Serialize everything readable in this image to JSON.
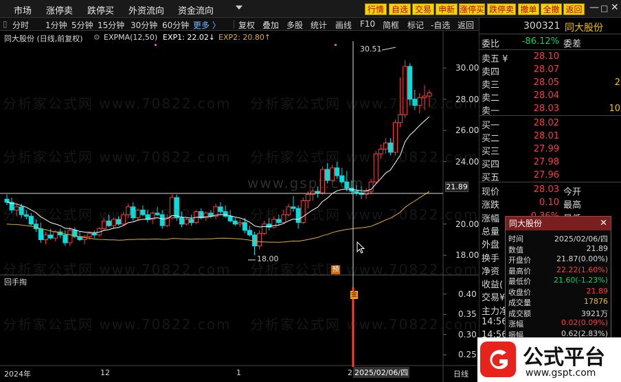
{
  "menu": {
    "items": [
      "市场",
      "涨停卖",
      "跌停买",
      "外资流向",
      "资金流向"
    ],
    "buttons": [
      "行情",
      "自选",
      "交易",
      "申新",
      "涨停买",
      "跌停卖",
      "撤单",
      "全撤",
      "返回"
    ],
    "controls": [
      "—",
      "□",
      "✕"
    ]
  },
  "toolbar": {
    "periods": [
      "分时",
      "1分钟",
      "5分钟",
      "15分钟",
      "30分钟",
      "60分钟",
      "更多 〉"
    ],
    "tools": [
      "复权",
      "叠加",
      "多股",
      "统计",
      "画线",
      "F10",
      "简框",
      "标记",
      "-自选",
      "返回"
    ]
  },
  "legend": {
    "stock": "同大股份 (日线,前复权)",
    "indicator": "EXPMA(12,50)",
    "exp1": "EXP1: 22.02↓",
    "exp2": "EXP2: 20.80↑"
  },
  "chart_labels": {
    "high_marker": "30.51",
    "low_marker": "18.00",
    "cursor_price": "21.89",
    "pre_tag": "预",
    "sub_title": "回手掏",
    "sub_marker": "金",
    "x_labels": [
      "2024年",
      "12",
      "1",
      "2",
      "2025/02/06/四"
    ],
    "period_label": "日线"
  },
  "chart_data": {
    "type": "candlestick",
    "price_axis": [
      30.0,
      28.0,
      26.0,
      24.0,
      22.0,
      20.0,
      18.0
    ],
    "price_axis_labels": [
      "30.00",
      "28.00",
      "26.00",
      "24.00",
      "20.00",
      "18.00"
    ],
    "ylim": [
      17.0,
      31.5
    ],
    "sub_axis_labels": [
      "0.40",
      "0.35",
      "0.30",
      "0.25"
    ],
    "sub_ylim": [
      0.22,
      0.42
    ],
    "candles": [
      [
        21.6,
        21.9,
        21.2,
        21.4
      ],
      [
        21.4,
        21.7,
        20.7,
        20.9
      ],
      [
        20.9,
        21.3,
        20.5,
        21.1
      ],
      [
        21.1,
        21.3,
        20.4,
        20.6
      ],
      [
        20.6,
        20.9,
        20.3,
        20.5
      ],
      [
        20.5,
        20.7,
        19.9,
        20.0
      ],
      [
        20.0,
        20.3,
        19.5,
        19.7
      ],
      [
        19.7,
        20.1,
        18.8,
        19.0
      ],
      [
        19.0,
        19.5,
        18.7,
        19.3
      ],
      [
        19.3,
        19.7,
        19.0,
        19.1
      ],
      [
        19.1,
        19.6,
        18.9,
        19.5
      ],
      [
        19.5,
        19.7,
        19.1,
        19.3
      ],
      [
        19.3,
        19.6,
        18.6,
        18.8
      ],
      [
        18.8,
        19.8,
        18.6,
        19.6
      ],
      [
        19.6,
        19.8,
        19.1,
        19.2
      ],
      [
        19.2,
        19.5,
        18.9,
        19.0
      ],
      [
        19.0,
        19.3,
        18.7,
        19.2
      ],
      [
        19.2,
        19.5,
        19.0,
        19.4
      ],
      [
        19.4,
        19.6,
        19.1,
        19.3
      ],
      [
        19.3,
        19.8,
        19.2,
        19.7
      ],
      [
        19.7,
        20.4,
        19.6,
        20.2
      ],
      [
        20.2,
        20.6,
        19.8,
        19.9
      ],
      [
        19.9,
        20.4,
        19.7,
        20.3
      ],
      [
        20.3,
        20.5,
        19.9,
        20.0
      ],
      [
        20.0,
        20.8,
        19.9,
        20.6
      ],
      [
        20.6,
        21.3,
        20.4,
        21.1
      ],
      [
        21.1,
        21.4,
        20.2,
        20.4
      ],
      [
        20.4,
        21.0,
        20.2,
        20.9
      ],
      [
        20.9,
        21.2,
        20.5,
        20.6
      ],
      [
        20.6,
        20.9,
        20.1,
        20.3
      ],
      [
        20.3,
        20.8,
        20.0,
        20.7
      ],
      [
        20.7,
        21.1,
        20.5,
        20.6
      ],
      [
        20.6,
        20.9,
        19.7,
        19.9
      ],
      [
        19.9,
        20.6,
        19.8,
        20.4
      ],
      [
        20.4,
        21.9,
        20.3,
        21.7
      ],
      [
        21.7,
        21.9,
        20.2,
        20.4
      ],
      [
        20.4,
        20.8,
        19.8,
        20.0
      ],
      [
        20.0,
        20.4,
        19.9,
        20.3
      ],
      [
        20.3,
        20.6,
        19.9,
        20.1
      ],
      [
        20.1,
        20.9,
        20.0,
        20.8
      ],
      [
        20.8,
        21.0,
        20.3,
        20.4
      ],
      [
        20.4,
        20.8,
        20.2,
        20.7
      ],
      [
        20.7,
        20.9,
        20.4,
        20.5
      ],
      [
        20.5,
        21.3,
        20.3,
        21.1
      ],
      [
        21.1,
        21.4,
        20.6,
        20.8
      ],
      [
        20.8,
        21.2,
        20.4,
        20.5
      ],
      [
        20.5,
        20.9,
        20.1,
        20.2
      ],
      [
        20.2,
        20.4,
        19.9,
        20.0
      ],
      [
        20.0,
        20.3,
        19.8,
        20.1
      ],
      [
        20.1,
        20.4,
        19.4,
        19.6
      ],
      [
        19.6,
        19.9,
        19.2,
        19.3
      ],
      [
        19.3,
        19.5,
        18.0,
        18.6
      ],
      [
        18.6,
        19.6,
        18.4,
        19.4
      ],
      [
        19.4,
        20.2,
        19.3,
        20.0
      ],
      [
        20.0,
        20.4,
        19.6,
        19.8
      ],
      [
        19.8,
        20.5,
        19.7,
        20.3
      ],
      [
        20.3,
        20.6,
        19.9,
        20.1
      ],
      [
        20.1,
        20.9,
        20.0,
        20.6
      ],
      [
        20.6,
        21.3,
        20.5,
        21.1
      ],
      [
        21.1,
        21.8,
        20.8,
        21.0
      ],
      [
        21.0,
        21.2,
        19.7,
        20.1
      ],
      [
        20.1,
        21.7,
        20.0,
        21.5
      ],
      [
        21.5,
        22.1,
        21.0,
        21.9
      ],
      [
        21.9,
        22.3,
        21.5,
        22.1
      ],
      [
        22.1,
        22.4,
        21.7,
        22.0
      ],
      [
        22.0,
        23.7,
        21.9,
        23.5
      ],
      [
        23.5,
        23.9,
        22.6,
        22.8
      ],
      [
        22.8,
        23.8,
        22.7,
        23.6
      ],
      [
        23.6,
        24.0,
        22.9,
        23.1
      ],
      [
        23.1,
        23.6,
        22.6,
        22.7
      ],
      [
        22.7,
        23.4,
        22.1,
        22.3
      ],
      [
        22.3,
        22.8,
        21.9,
        22.1
      ],
      [
        22.1,
        22.5,
        21.8,
        22.0
      ],
      [
        22.0,
        22.4,
        21.6,
        21.9
      ],
      [
        21.9,
        22.3,
        21.6,
        22.1
      ],
      [
        22.1,
        22.9,
        21.9,
        22.7
      ],
      [
        22.7,
        24.7,
        22.6,
        24.5
      ],
      [
        24.5,
        25.1,
        24.2,
        24.8
      ],
      [
        24.8,
        25.5,
        24.5,
        25.2
      ],
      [
        25.2,
        25.5,
        24.4,
        24.6
      ],
      [
        24.6,
        26.7,
        24.4,
        26.5
      ],
      [
        26.5,
        29.4,
        26.2,
        27.0
      ],
      [
        27.0,
        30.5,
        26.8,
        30.1
      ],
      [
        30.1,
        30.3,
        27.6,
        28.0
      ],
      [
        28.0,
        28.6,
        27.3,
        27.6
      ],
      [
        27.6,
        28.4,
        27.1,
        28.1
      ],
      [
        28.1,
        28.9,
        27.3,
        28.2
      ],
      [
        28.2,
        28.6,
        27.5,
        28.4
      ]
    ],
    "sub_events": [
      {
        "index": 75,
        "value": 0.4
      }
    ]
  },
  "right_panel": {
    "code": "300321",
    "name": "同大股份",
    "order_ratio_label": "委比",
    "order_ratio": "-86.12%",
    "order_diff_label": "委差",
    "asks": [
      {
        "label": "卖五 ¥",
        "price": "28.10",
        "vol": ""
      },
      {
        "label": "卖四",
        "price": "28.07",
        "vol": ""
      },
      {
        "label": "卖三",
        "price": "28.05",
        "vol": "2"
      },
      {
        "label": "卖二",
        "price": "28.04",
        "vol": ""
      },
      {
        "label": "卖一",
        "price": "28.03",
        "vol": "10"
      }
    ],
    "bids": [
      {
        "label": "买一",
        "price": "28.02",
        "vol": ""
      },
      {
        "label": "买二",
        "price": "28.01",
        "vol": ""
      },
      {
        "label": "买三",
        "price": "27.99",
        "vol": ""
      },
      {
        "label": "买四",
        "price": "27.98",
        "vol": ""
      },
      {
        "label": "买五",
        "price": "27.96",
        "vol": ""
      }
    ],
    "stats": [
      {
        "label": "现价",
        "value": "28.03",
        "right": "今开"
      },
      {
        "label": "涨跌",
        "value": "0.10",
        "right": "最高"
      },
      {
        "label": "涨幅",
        "value": "0.36%",
        "right": "最低"
      },
      {
        "label": "总量",
        "value": "",
        "right": ""
      },
      {
        "label": "外盘",
        "value": "",
        "right": ""
      },
      {
        "label": "换手",
        "value": "",
        "right": ""
      },
      {
        "label": "净资",
        "value": "",
        "right": ""
      },
      {
        "label": "收益(",
        "value": "",
        "right": ""
      },
      {
        "label": "交易¥",
        "value": "",
        "right": ""
      },
      {
        "label": "主力净",
        "value": "",
        "right": ""
      },
      {
        "label": "14:56",
        "value": "",
        "right": ""
      },
      {
        "label": "14:56",
        "value": "",
        "right": ""
      }
    ]
  },
  "popup": {
    "title": "同大股份",
    "rows": [
      {
        "label": "时间",
        "value": "2025/02/06/四",
        "color": "#d8d8d8"
      },
      {
        "label": "数值",
        "value": "21.89",
        "color": "#d8d8d8"
      },
      {
        "label": "开盘价",
        "value": "21.87(0.00%)",
        "color": "#d8d8d8"
      },
      {
        "label": "最高价",
        "value": "22.22(1.60%)",
        "color": "#ff3b3b"
      },
      {
        "label": "最低价",
        "value": "21.60(-1.23%)",
        "color": "#00d060"
      },
      {
        "label": "收盘价",
        "value": "21.89",
        "color": "#ff3b3b"
      },
      {
        "label": "成交量",
        "value": "17876",
        "color": "#f0c000"
      },
      {
        "label": "成交额",
        "value": "3921万",
        "color": "#d8d8d8"
      },
      {
        "label": "涨幅",
        "value": "0.02(0.09%)",
        "color": "#ff3b3b"
      },
      {
        "label": "振幅",
        "value": "0.62(2.83%)",
        "color": "#d8d8d8"
      }
    ]
  },
  "watermark": "分析家公式网 www.70822.com",
  "watermark_center": "www.gspt.com",
  "logo": {
    "brand": "公式平台",
    "url": "www.gspt.com"
  },
  "colors": {
    "up": "#ff3b3b",
    "down": "#00e0e0",
    "exp1": "#ffffff",
    "exp2": "#e0b020",
    "accent": "#f5d400"
  }
}
